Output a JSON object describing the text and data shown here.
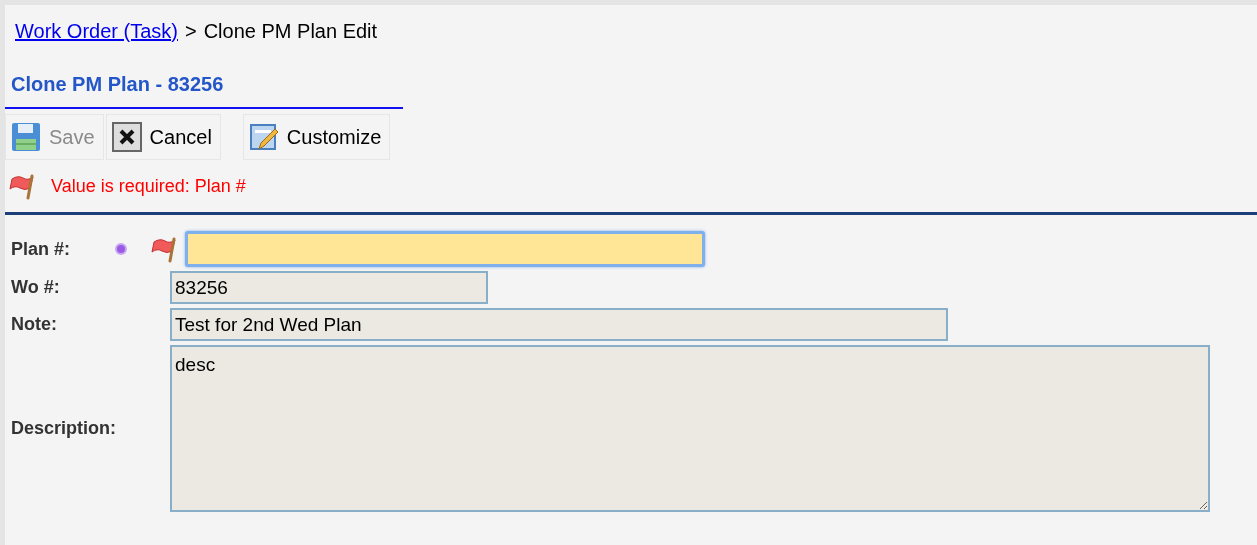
{
  "breadcrumb": {
    "link": "Work Order (Task)",
    "separator": ">",
    "current": "Clone PM Plan Edit"
  },
  "title": "Clone PM Plan - 83256",
  "toolbar": [
    {
      "label": "Save",
      "kind": "save",
      "disabled": true
    },
    {
      "label": "Cancel",
      "kind": "cancel",
      "disabled": false
    },
    {
      "label": "Customize",
      "kind": "customize",
      "disabled": false
    }
  ],
  "error": "Value is required: Plan #",
  "fields": [
    {
      "label": "Plan #:",
      "kind": "input",
      "required": true,
      "error": true,
      "focused": true
    },
    {
      "label": "Wo #:",
      "kind": "input",
      "value": "83256",
      "required": false,
      "error": false,
      "focused": false
    },
    {
      "label": "Note:",
      "kind": "input",
      "value": "Test for 2nd Wed Plan",
      "required": false,
      "error": false,
      "focused": false
    },
    {
      "label": "Description:",
      "kind": "textarea",
      "value": "desc",
      "required": false,
      "error": false,
      "focused": false
    }
  ]
}
